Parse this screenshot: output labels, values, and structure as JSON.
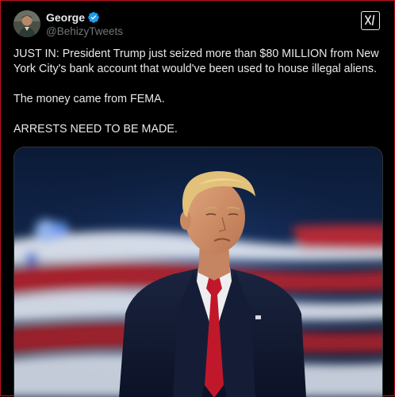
{
  "author": {
    "display_name": "George",
    "handle": "@BehizyTweets",
    "verified": true,
    "verified_color": "#1d9bf0"
  },
  "icons": {
    "avatar": "profile-photo",
    "verified": "verified-badge-icon",
    "logo": "x-logo-icon"
  },
  "tweet": {
    "paragraphs": [
      "JUST IN: President Trump just seized more than $80 MILLION from New York City's bank account that would've been used to house illegal aliens.",
      "The money came from FEMA.",
      "ARRESTS NEED TO BE MADE."
    ]
  },
  "media": {
    "type": "photo"
  },
  "colors": {
    "background": "#000000",
    "text": "#e7e9ea",
    "secondary_text": "#71767b",
    "frame_border": "#c4141c"
  }
}
